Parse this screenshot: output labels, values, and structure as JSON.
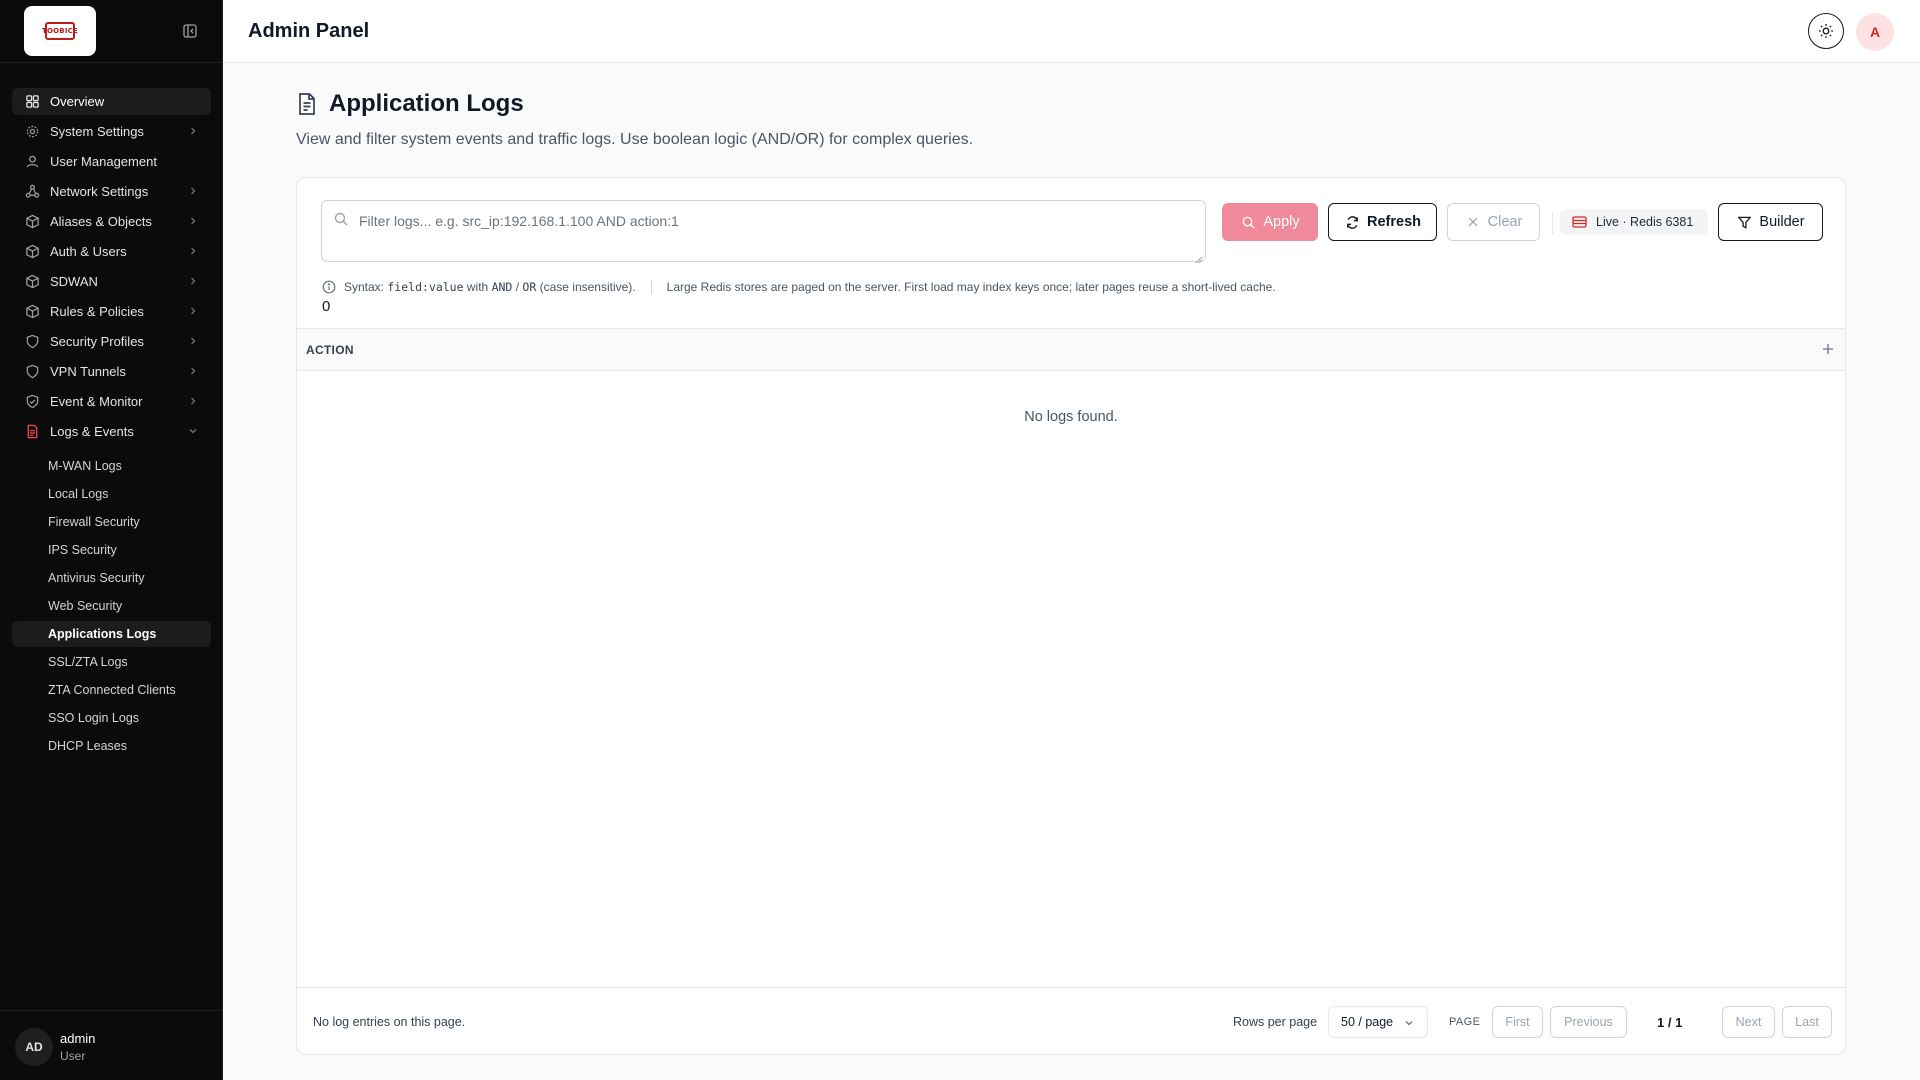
{
  "sidebar": {
    "logo_text": "TOOBICE",
    "nav": [
      {
        "label": "Overview",
        "icon": "grid-icon",
        "active": true,
        "chevron": false
      },
      {
        "label": "System Settings",
        "icon": "gear-icon",
        "chevron": true
      },
      {
        "label": "User Management",
        "icon": "user-icon",
        "chevron": false
      },
      {
        "label": "Network Settings",
        "icon": "network-icon",
        "chevron": true
      },
      {
        "label": "Aliases & Objects",
        "icon": "box-icon",
        "chevron": true
      },
      {
        "label": "Auth & Users",
        "icon": "box-icon",
        "chevron": true
      },
      {
        "label": "SDWAN",
        "icon": "box-icon",
        "chevron": true
      },
      {
        "label": "Rules & Policies",
        "icon": "box-icon",
        "chevron": true
      },
      {
        "label": "Security Profiles",
        "icon": "shield-icon",
        "chevron": true
      },
      {
        "label": "VPN Tunnels",
        "icon": "shield-icon",
        "chevron": true
      },
      {
        "label": "Event & Monitor",
        "icon": "shield-check-icon",
        "chevron": true
      },
      {
        "label": "Logs & Events",
        "icon": "log-file-icon",
        "chevron": true,
        "expanded": true
      }
    ],
    "subitems": [
      {
        "label": "M-WAN Logs"
      },
      {
        "label": "Local Logs"
      },
      {
        "label": "Firewall Security"
      },
      {
        "label": "IPS Security"
      },
      {
        "label": "Antivirus Security"
      },
      {
        "label": "Web Security"
      },
      {
        "label": "Applications Logs",
        "active": true
      },
      {
        "label": "SSL/ZTA Logs"
      },
      {
        "label": "ZTA Connected Clients"
      },
      {
        "label": "SSO Login Logs"
      },
      {
        "label": "DHCP Leases"
      }
    ],
    "user": {
      "initials": "AD",
      "name": "admin",
      "role": "User"
    }
  },
  "header": {
    "title": "Admin Panel",
    "avatar_letter": "A"
  },
  "page": {
    "title": "Application Logs",
    "description": "View and filter system events and traffic logs. Use boolean logic (AND/OR) for complex queries."
  },
  "filter": {
    "placeholder": "Filter logs... e.g. src_ip:192.168.1.100 AND action:1",
    "value": "",
    "apply_label": "Apply",
    "refresh_label": "Refresh",
    "clear_label": "Clear",
    "live_label": "Live · Redis 6381",
    "builder_label": "Builder",
    "syntax_prefix": "Syntax:",
    "syntax_code": "field:value",
    "syntax_with": "with",
    "syntax_and": "AND",
    "syntax_slash": "/",
    "syntax_or": "OR",
    "syntax_suffix": "(case insensitive).",
    "redis_note": "Large Redis stores are paged on the server. First load may index keys once; later pages reuse a short-lived cache.",
    "count": "0"
  },
  "table": {
    "columns": [
      "ACTION"
    ],
    "empty_text": "No logs found."
  },
  "footer": {
    "summary": "No log entries on this page.",
    "rows_per_page_label": "Rows per page",
    "rows_per_page_value": "50 / page",
    "page_label": "PAGE",
    "first": "First",
    "previous": "Previous",
    "indicator": "1 / 1",
    "next": "Next",
    "last": "Last"
  },
  "colors": {
    "sidebar_bg": "#0b0b0c",
    "accent": "#dc2626",
    "apply_bg": "#f08a9a"
  }
}
